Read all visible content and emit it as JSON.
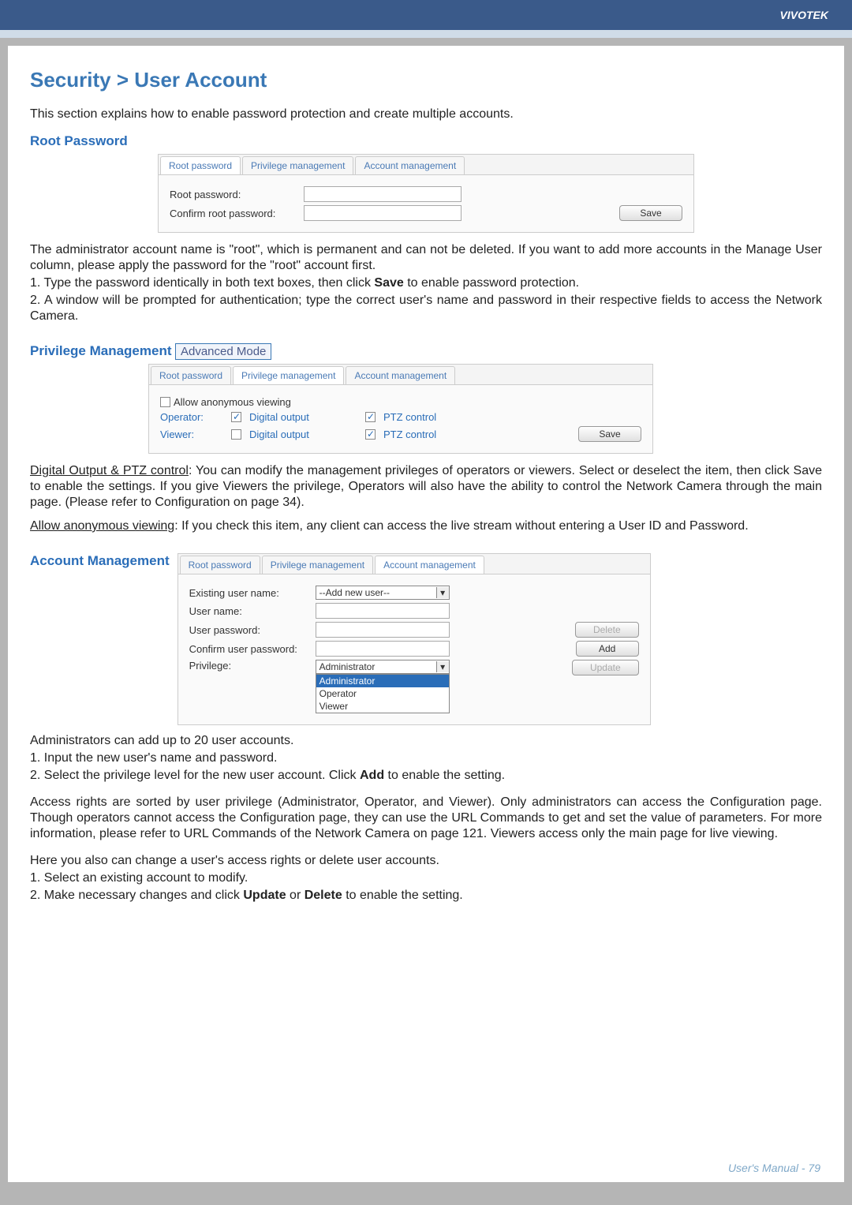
{
  "brand": "VIVOTEK",
  "footer": "User's Manual - 79",
  "section": {
    "title": "Security > User Account",
    "intro": "This section explains how to enable password protection and create multiple accounts."
  },
  "root_password": {
    "heading": "Root Password",
    "tabs": {
      "root": "Root password",
      "priv": "Privilege management",
      "acct": "Account management"
    },
    "labels": {
      "root_pw": "Root password:",
      "confirm_pw": "Confirm root password:"
    },
    "save": "Save",
    "para1": "The administrator account name is \"root\", which is permanent and can not be deleted. If you want to add more accounts in the Manage User column, please apply the password for the \"root\" account first.",
    "step1": "1. Type the password identically in both text boxes, then click Save to enable password protection.",
    "step2": "2. A window will be prompted for authentication; type the correct user's name and password in their respective fields to access the Network Camera."
  },
  "priv_mgmt": {
    "heading": "Privilege Management",
    "adv_mode": "Advanced Mode",
    "tabs": {
      "root": "Root password",
      "priv": "Privilege management",
      "acct": "Account management"
    },
    "allow_anon": "Allow anonymous viewing",
    "operator_label": "Operator:",
    "viewer_label": "Viewer:",
    "digital_output": "Digital output",
    "ptz_control": "PTZ control",
    "save": "Save",
    "para_do_ptz_label": "Digital Output & PTZ control",
    "para_do_ptz": ": You can modify the management privileges of operators or viewers. Select or deselect the item, then click Save to enable the settings. If you give Viewers the privilege, Operators will also have the ability to control the Network Camera through the main page. (Please refer to Configuration on page 34).",
    "para_anon_label": "Allow anonymous viewing",
    "para_anon": ": If you check this item, any client can access the live stream without entering a User ID and Password."
  },
  "acct_mgmt": {
    "heading": "Account Management",
    "tabs": {
      "root": "Root password",
      "priv": "Privilege management",
      "acct": "Account management"
    },
    "labels": {
      "existing": "Existing user name:",
      "username": "User name:",
      "userpw": "User password:",
      "confirmpw": "Confirm user password:",
      "privilege": "Privilege:"
    },
    "add_new_user": "--Add new user--",
    "priv_options": {
      "admin": "Administrator",
      "admin_sel": "Administrator",
      "operator": "Operator",
      "viewer": "Viewer"
    },
    "buttons": {
      "delete": "Delete",
      "add": "Add",
      "update": "Update"
    },
    "para1": "Administrators can add up to 20 user accounts.",
    "step1": "1. Input the new user's name and password.",
    "step2": "2. Select the privilege level for the new user account. Click Add to enable the setting.",
    "para2": "Access rights are sorted by user privilege (Administrator, Operator, and Viewer). Only administrators can access the Configuration page. Though operators cannot access the Configuration page, they can use the URL Commands to get and set the value of parameters. For more information, please refer to URL Commands of the Network Camera on page 121. Viewers access only the main page for live viewing.",
    "para3": "Here you also can change a user's access rights or delete user accounts.",
    "step3": "1. Select an existing account to modify.",
    "step4": "2. Make necessary changes and click Update or Delete to enable the setting."
  }
}
